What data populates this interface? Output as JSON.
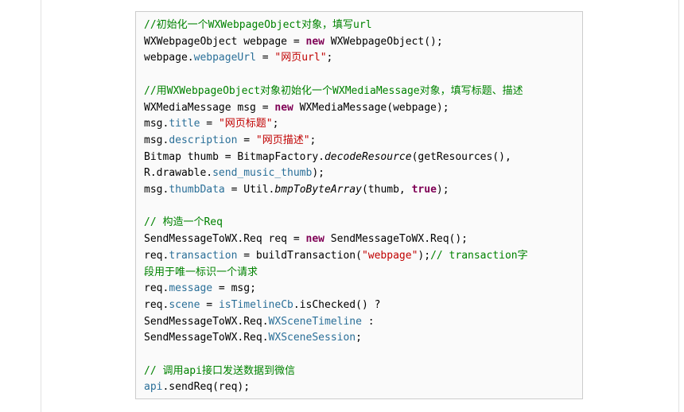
{
  "code": {
    "lines": [
      [
        {
          "t": "//初始化一个WXWebpageObject对象，填写url",
          "c": "comment"
        }
      ],
      [
        {
          "t": "WXWebpageObject webpage = ",
          "c": "plain"
        },
        {
          "t": "new",
          "c": "keyword"
        },
        {
          "t": " WXWebpageObject();",
          "c": "plain"
        }
      ],
      [
        {
          "t": "webpage.",
          "c": "plain"
        },
        {
          "t": "webpageUrl",
          "c": "field"
        },
        {
          "t": " = ",
          "c": "plain"
        },
        {
          "t": "\"网页url\"",
          "c": "string"
        },
        {
          "t": ";",
          "c": "plain"
        }
      ],
      [],
      [
        {
          "t": "//用WXWebpageObject对象初始化一个WXMediaMessage对象，填写标题、描述",
          "c": "comment"
        }
      ],
      [
        {
          "t": "WXMediaMessage msg = ",
          "c": "plain"
        },
        {
          "t": "new",
          "c": "keyword"
        },
        {
          "t": " WXMediaMessage(webpage);",
          "c": "plain"
        }
      ],
      [
        {
          "t": "msg.",
          "c": "plain"
        },
        {
          "t": "title",
          "c": "field"
        },
        {
          "t": " = ",
          "c": "plain"
        },
        {
          "t": "\"网页标题\"",
          "c": "string"
        },
        {
          "t": ";",
          "c": "plain"
        }
      ],
      [
        {
          "t": "msg.",
          "c": "plain"
        },
        {
          "t": "description",
          "c": "field"
        },
        {
          "t": " = ",
          "c": "plain"
        },
        {
          "t": "\"网页描述\"",
          "c": "string"
        },
        {
          "t": ";",
          "c": "plain"
        }
      ],
      [
        {
          "t": "Bitmap thumb = BitmapFactory.",
          "c": "plain"
        },
        {
          "t": "decodeResource",
          "c": "italic"
        },
        {
          "t": "(getResources(),",
          "c": "plain"
        }
      ],
      [
        {
          "t": "R.drawable.",
          "c": "plain"
        },
        {
          "t": "send_music_thumb",
          "c": "field"
        },
        {
          "t": ");",
          "c": "plain"
        }
      ],
      [
        {
          "t": "msg.",
          "c": "plain"
        },
        {
          "t": "thumbData",
          "c": "field"
        },
        {
          "t": " = Util.",
          "c": "plain"
        },
        {
          "t": "bmpToByteArray",
          "c": "italic"
        },
        {
          "t": "(thumb, ",
          "c": "plain"
        },
        {
          "t": "true",
          "c": "keyword"
        },
        {
          "t": ");",
          "c": "plain"
        }
      ],
      [],
      [
        {
          "t": "// 构造一个Req",
          "c": "comment"
        }
      ],
      [
        {
          "t": "SendMessageToWX.Req req = ",
          "c": "plain"
        },
        {
          "t": "new",
          "c": "keyword"
        },
        {
          "t": " SendMessageToWX.Req();",
          "c": "plain"
        }
      ],
      [
        {
          "t": "req.",
          "c": "plain"
        },
        {
          "t": "transaction",
          "c": "field"
        },
        {
          "t": " = buildTransaction(",
          "c": "plain"
        },
        {
          "t": "\"webpage\"",
          "c": "string"
        },
        {
          "t": ");",
          "c": "plain"
        },
        {
          "t": "// transaction字",
          "c": "comment"
        }
      ],
      [
        {
          "t": "段用于唯一标识一个请求",
          "c": "comment"
        }
      ],
      [
        {
          "t": "req.",
          "c": "plain"
        },
        {
          "t": "message",
          "c": "field"
        },
        {
          "t": " = msg;",
          "c": "plain"
        }
      ],
      [
        {
          "t": "req.",
          "c": "plain"
        },
        {
          "t": "scene",
          "c": "field"
        },
        {
          "t": " = ",
          "c": "plain"
        },
        {
          "t": "isTimelineCb",
          "c": "field"
        },
        {
          "t": ".isChecked() ?",
          "c": "plain"
        }
      ],
      [
        {
          "t": "SendMessageToWX.Req.",
          "c": "plain"
        },
        {
          "t": "WXSceneTimeline",
          "c": "field"
        },
        {
          "t": " :",
          "c": "plain"
        }
      ],
      [
        {
          "t": "SendMessageToWX.Req.",
          "c": "plain"
        },
        {
          "t": "WXSceneSession",
          "c": "field"
        },
        {
          "t": ";",
          "c": "plain"
        }
      ],
      [],
      [
        {
          "t": "// 调用api接口发送数据到微信",
          "c": "comment"
        }
      ],
      [
        {
          "t": "api",
          "c": "field"
        },
        {
          "t": ".sendReq(req);",
          "c": "plain"
        }
      ]
    ]
  }
}
